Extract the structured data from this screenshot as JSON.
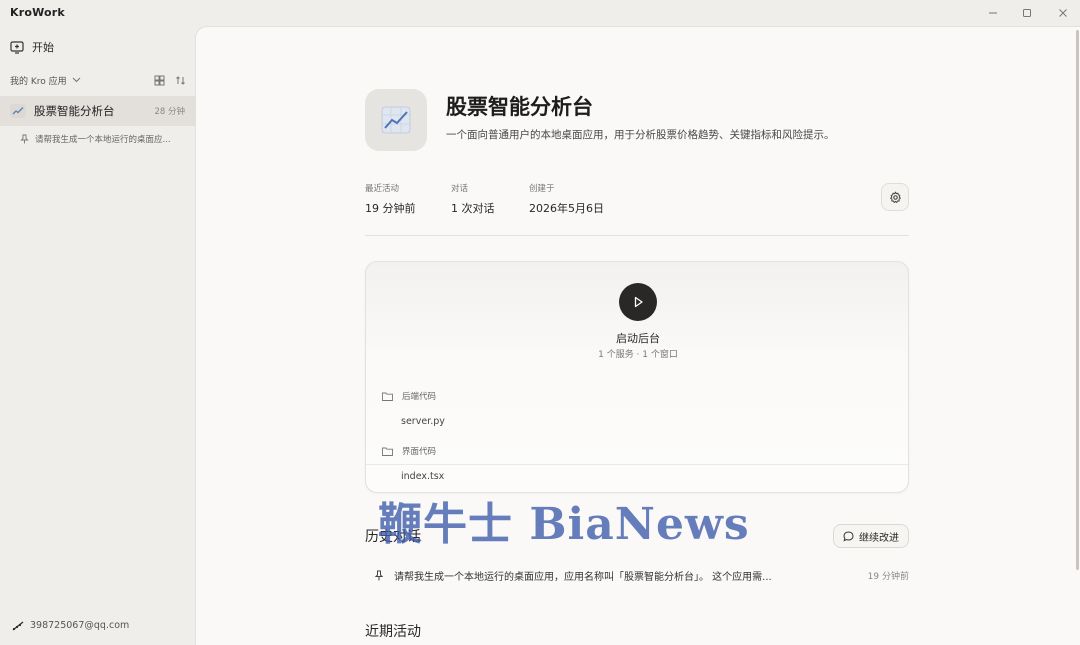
{
  "window": {
    "title": "KroWork"
  },
  "sidebar": {
    "start_label": "开始",
    "apps_header": "我的 Kro 应用",
    "apps": [
      {
        "name": "股票智能分析台",
        "time": "28 分钟"
      }
    ],
    "conversations": [
      {
        "text": "请帮我生成一个本地运行的桌面应..."
      }
    ],
    "account": "398725067@qq.com"
  },
  "main": {
    "title": "股票智能分析台",
    "description": "一个面向普通用户的本地桌面应用，用于分析股票价格趋势、关键指标和风险提示。",
    "meta": [
      {
        "label": "最近活动",
        "value": "19 分钟前"
      },
      {
        "label": "对话",
        "value": "1 次对话"
      },
      {
        "label": "创建于",
        "value": "2026年5月6日"
      }
    ],
    "launcher": {
      "label": "启动后台",
      "sub": "1 个服务 · 1 个窗口",
      "folders": [
        {
          "name": "后端代码",
          "file": "server.py"
        },
        {
          "name": "界面代码",
          "file": "index.tsx"
        }
      ]
    },
    "history": {
      "title": "历史对话",
      "continue_label": "继续改进",
      "items": [
        {
          "text": "请帮我生成一个本地运行的桌面应用，应用名称叫「股票智能分析台」。 这个应用需...",
          "time": "19 分钟前"
        }
      ]
    },
    "recent": {
      "title": "近期活动"
    }
  },
  "watermark": "鞭牛士 BiaNews",
  "colors": {
    "sidebar_bg": "#f0eeeb",
    "main_bg": "#faf9f7",
    "selected_item_bg": "#e3e0dc",
    "play_button": "#2a2826",
    "watermark": "#3c5aaa"
  }
}
